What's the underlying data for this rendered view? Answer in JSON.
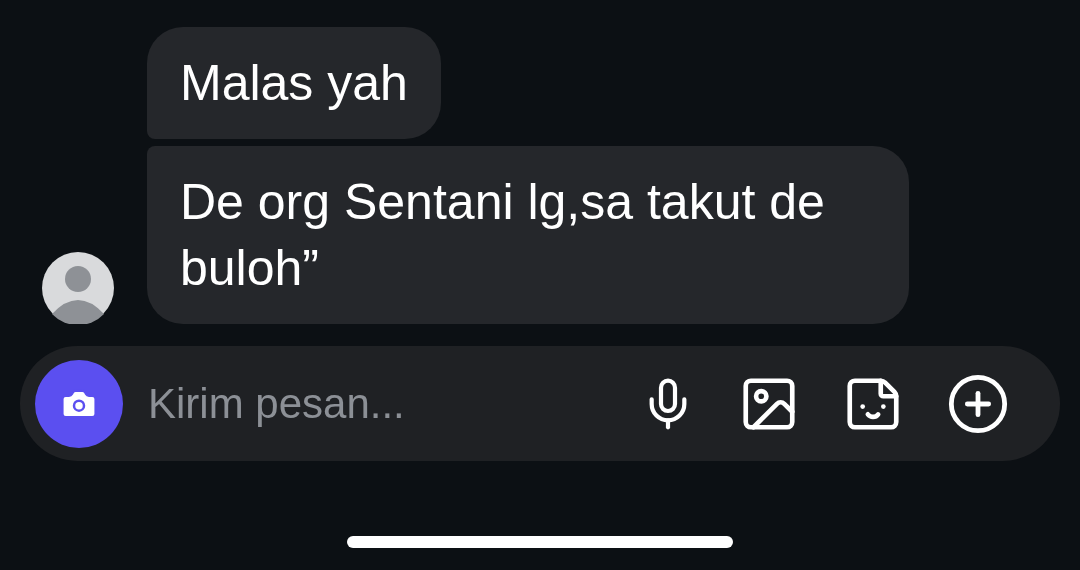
{
  "messages": [
    {
      "text": "Malas yah"
    },
    {
      "text": "De org Sentani lg,sa takut de buloh”"
    }
  ],
  "composer": {
    "placeholder": "Kirim pesan..."
  }
}
